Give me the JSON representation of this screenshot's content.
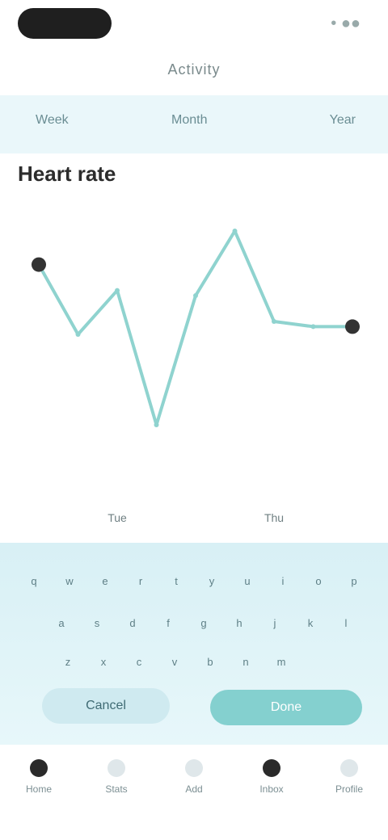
{
  "status_bar": {
    "right_text": "• ●●"
  },
  "top_nav": {
    "title": "Activity"
  },
  "filters": [
    {
      "label": "Week"
    },
    {
      "label": "Month"
    },
    {
      "label": "Year"
    }
  ],
  "section": {
    "title": "Heart rate"
  },
  "chart_data": {
    "type": "line",
    "x": [
      0,
      1,
      2,
      3,
      4,
      5,
      6,
      7,
      8
    ],
    "values": [
      82,
      55,
      72,
      20,
      70,
      95,
      60,
      58,
      58
    ],
    "ylim": [
      0,
      100
    ],
    "xticks": [
      "",
      "",
      "Tue",
      "",
      "",
      "",
      "Thu",
      "",
      ""
    ],
    "color": "#8fd3cf"
  },
  "keyboard": {
    "row1": [
      "q",
      "w",
      "e",
      "r",
      "t",
      "y",
      "u",
      "i",
      "o",
      "p"
    ],
    "row2": [
      "a",
      "s",
      "d",
      "f",
      "g",
      "h",
      "j",
      "k",
      "l"
    ],
    "row3": [
      "z",
      "x",
      "c",
      "v",
      "b",
      "n",
      "m"
    ],
    "secondary_label": "Cancel",
    "primary_label": "Done"
  },
  "bottom_nav": [
    {
      "label": "Home",
      "icon": "home-icon"
    },
    {
      "label": "Stats",
      "icon": "stats-icon"
    },
    {
      "label": "Add",
      "icon": "add-icon"
    },
    {
      "label": "Inbox",
      "icon": "inbox-icon"
    },
    {
      "label": "Profile",
      "icon": "profile-icon"
    }
  ]
}
